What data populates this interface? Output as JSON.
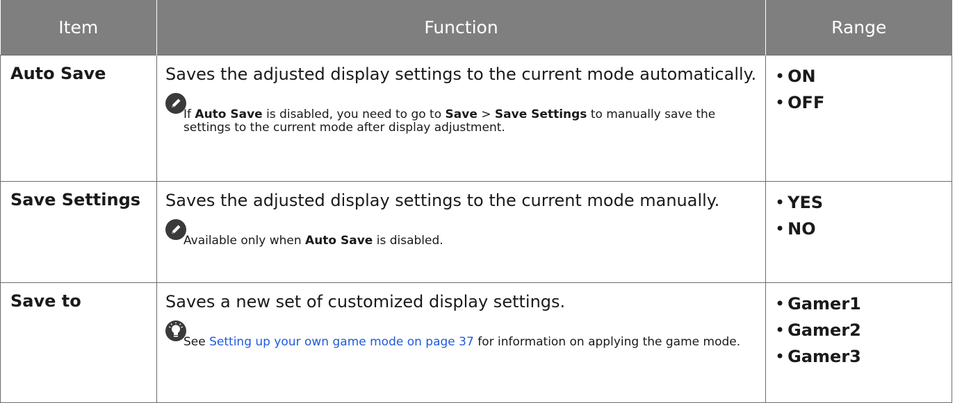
{
  "headers": {
    "item": "Item",
    "function": "Function",
    "range": "Range"
  },
  "rows": [
    {
      "item": "Auto Save",
      "function": "Saves the adjusted display settings to the current mode automatically.",
      "note": {
        "icon": "pencil-icon",
        "prefix": "If ",
        "bold1": "Auto Save",
        "mid1": " is disabled, you need to go to ",
        "bold2": "Save",
        "mid2": " > ",
        "bold3": "Save Settings",
        "suffix": " to manually save the settings to the current mode after display adjustment."
      },
      "options": [
        "ON",
        "OFF"
      ]
    },
    {
      "item": "Save Settings",
      "function": "Saves the adjusted display settings to the current mode manually.",
      "note": {
        "icon": "pencil-icon",
        "prefix": "Available only when ",
        "bold1": "Auto Save",
        "suffix": " is disabled."
      },
      "options": [
        "YES",
        "NO"
      ]
    },
    {
      "item": "Save to",
      "function": "Saves a new set of customized display settings.",
      "note": {
        "icon": "lightbulb-icon",
        "prefix": "See ",
        "link": "Setting up your own game mode on page 37",
        "suffix": " for information on applying the game mode."
      },
      "options": [
        "Gamer1",
        "Gamer2",
        "Gamer3"
      ]
    }
  ],
  "bullet": "•",
  "colors": {
    "header_bg": "#7f7f7f",
    "link": "#1f5bdc",
    "icon_bg": "#3a3a3a"
  }
}
